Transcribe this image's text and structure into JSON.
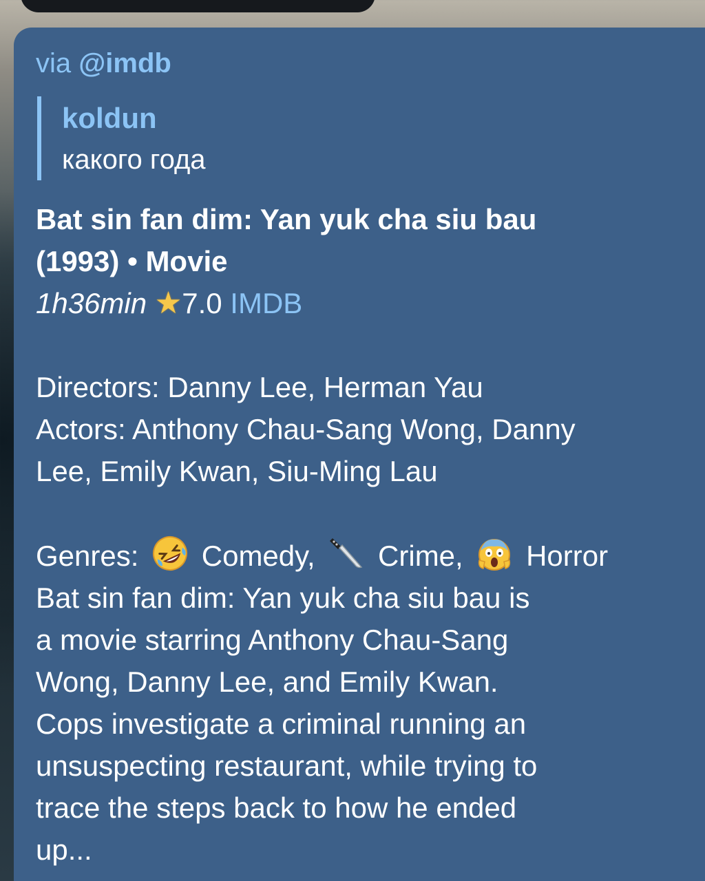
{
  "forward": {
    "via_label": "via",
    "bot_handle": "@imdb"
  },
  "reply": {
    "author": "koldun",
    "text": "какого года"
  },
  "movie": {
    "title": "Bat sin fan dim: Yan yuk cha siu bau",
    "year_type": "(1993) • Movie",
    "runtime": "1h36min",
    "rating": "7.0",
    "rating_source": "IMDB",
    "directors_line": "Directors: Danny Lee, Herman Yau",
    "actors_line1": "Actors: Anthony Chau-Sang Wong, Danny",
    "actors_line2": "Lee, Emily Kwan, Siu-Ming Lau",
    "genres_label": "Genres:",
    "genres": [
      {
        "name": "Comedy,",
        "icon": "rolling-laughing-emoji"
      },
      {
        "name": "Crime,",
        "icon": "knife-emoji"
      },
      {
        "name": "Horror",
        "icon": "screaming-face-emoji"
      }
    ],
    "description_lines": [
      "Bat sin fan dim: Yan yuk cha siu bau is",
      "a movie starring Anthony Chau-Sang",
      "Wong, Danny Lee, and Emily Kwan.",
      "Cops investigate a criminal running an",
      "unsuspecting restaurant, while trying to",
      "trace the steps back to how he ended",
      "up..."
    ]
  },
  "colors": {
    "bubble": "#3d6089",
    "link": "#8cc4f5",
    "text": "#ffffff"
  }
}
